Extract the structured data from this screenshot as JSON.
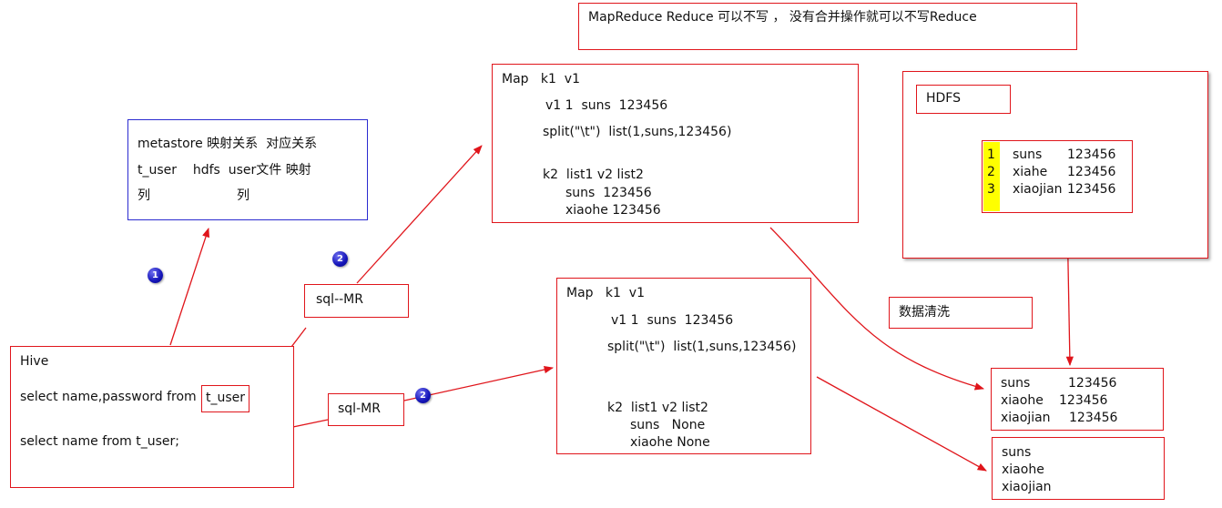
{
  "note": {
    "text": "MapReduce Reduce 可以不写 ， 没有合并操作就可以不写Reduce"
  },
  "metastore": {
    "line1": "metastore 映射关系  对应关系",
    "line2": "t_user    hdfs  user文件 映射",
    "line3a": "列",
    "line3b": "列"
  },
  "hive": {
    "title": "Hive",
    "query1": "select name,password from",
    "table1": "t_user",
    "query2": "select name from t_user;"
  },
  "map_top": {
    "header": "Map   k1  v1",
    "line1": "v1 1  suns  123456",
    "line2": "split(\"\\t\")  list(1,suns,123456)",
    "line3": "k2  list1 v2 list2",
    "line4": "suns  123456",
    "line5": "xiaohe 123456"
  },
  "map_bottom": {
    "header": "Map   k1  v1",
    "line1": "v1 1  suns  123456",
    "line2": "split(\"\\t\")  list(1,suns,123456)",
    "line3": "k2  list1 v2 list2",
    "line4": "suns   None",
    "line5": "xiaohe None"
  },
  "sqlmr_top": {
    "label": "sql--MR"
  },
  "sqlmr_bottom": {
    "label": "sql-MR"
  },
  "badges": {
    "b1": "1",
    "b2a": "2",
    "b2b": "2"
  },
  "hdfs": {
    "label": "HDFS",
    "rows": [
      {
        "num": "1",
        "name": "suns",
        "value": "123456"
      },
      {
        "num": "2",
        "name": "xiahe",
        "value": "123456"
      },
      {
        "num": "3",
        "name": "xiaojian",
        "value": "123456"
      }
    ]
  },
  "cleaning": {
    "label": "数据清洗"
  },
  "result_full": {
    "rows": [
      {
        "name": "suns",
        "value": "123456"
      },
      {
        "name": "xiaohe",
        "value": "123456"
      },
      {
        "name": "xiaojian",
        "value": "123456"
      }
    ]
  },
  "result_names": {
    "rows": [
      "suns",
      "xiaohe",
      "xiaojian"
    ]
  },
  "colors": {
    "box_border": "#e0151b",
    "metastore_border": "#2b2bd0",
    "arrow": "#e0151b",
    "highlight": "#ffff00",
    "badge": "#1414b8"
  }
}
